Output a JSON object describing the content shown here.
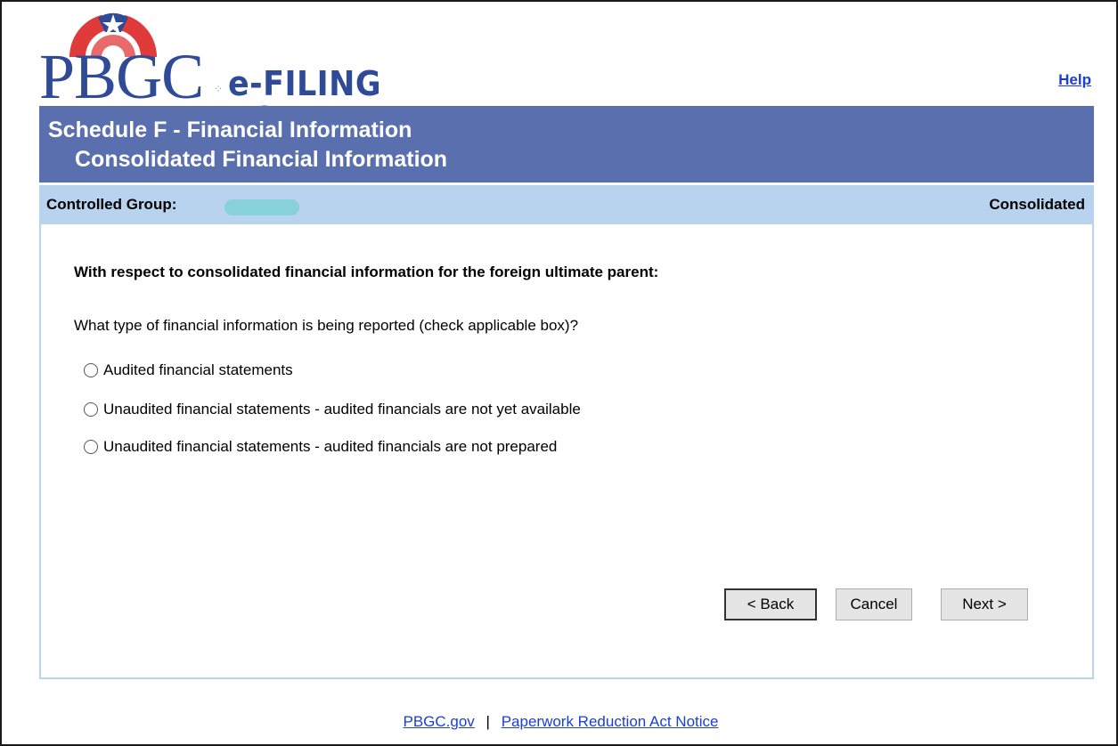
{
  "header": {
    "logo_text": "PBGC",
    "portal_name": "e-FILING PORTAL",
    "help_label": "Help"
  },
  "title": {
    "line1": "Schedule F - Financial Information",
    "line2": "Consolidated Financial Information"
  },
  "group_bar": {
    "label": "Controlled Group:",
    "type": "Consolidated"
  },
  "content": {
    "heading": "With respect to consolidated financial information for the foreign ultimate parent:",
    "question": "What type of financial information is being reported (check applicable box)?",
    "options": [
      {
        "label": "Audited financial statements",
        "selected": false
      },
      {
        "label": "Unaudited financial statements - audited financials are not yet available",
        "selected": false
      },
      {
        "label": "Unaudited financial statements - audited financials are not prepared",
        "selected": false
      }
    ]
  },
  "buttons": {
    "back": "< Back",
    "cancel": "Cancel",
    "next": "Next >"
  },
  "footer": {
    "link1": "PBGC.gov",
    "separator": "|",
    "link2": "Paperwork Reduction Act Notice"
  },
  "colors": {
    "brand_blue": "#2f4a96",
    "title_band": "#5a6fae",
    "group_bar": "#b7d3ee",
    "logo_red": "#e03a3a",
    "link": "#1a3ed8"
  }
}
